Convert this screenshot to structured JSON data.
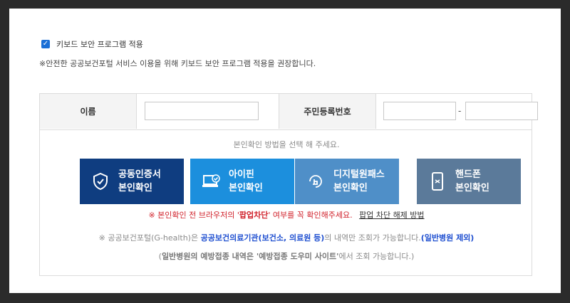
{
  "keyboard": {
    "checked": true,
    "label": "키보드 보안 프로그램 적용",
    "note": "※안전한 공공보건포털 서비스 이용을 위해 키보드 보안 프로그램 적용을 권장합니다."
  },
  "form": {
    "name_label": "이름",
    "name_value": "",
    "rrn_label": "주민등록번호",
    "rrn_front": "",
    "rrn_back": "",
    "dash": "-"
  },
  "auth": {
    "hint": "본인확인 방법을 선택 해 주세요.",
    "buttons": [
      {
        "label": "공동인증서\n본인확인",
        "icon": "shield-icon",
        "color": "#0f3d80"
      },
      {
        "label": "아이핀\n본인확인",
        "icon": "laptop-check-icon",
        "color": "#1c8fdd"
      },
      {
        "label": "디지털원패스\n본인확인",
        "icon": "touch-icon",
        "color": "#4f8fc8"
      },
      {
        "label": "핸드폰\n본인확인",
        "icon": "mobile-phone-icon",
        "color": "#5b7a9a"
      }
    ]
  },
  "popup": {
    "prefix": "※ 본인확인 전 브라우저의 '",
    "bold": "팝업차단",
    "suffix": "' 여부를 꼭 확인해주세요.",
    "link": "팝업 차단 해제 방법"
  },
  "info": {
    "line1_a": "※ 공공보건포털(G-health)은 ",
    "line1_b": "공공보건의료기관(보건소, 의료원 등)",
    "line1_c": "의 내역만 조회가 가능합니다.",
    "line1_d": "(일반병원 제외)",
    "line2_a": "(",
    "line2_b": "일반병원의 예방접종 내역은 '예방접종 도우미 사이트'",
    "line2_c": "에서 조회 가능합니다.)"
  }
}
